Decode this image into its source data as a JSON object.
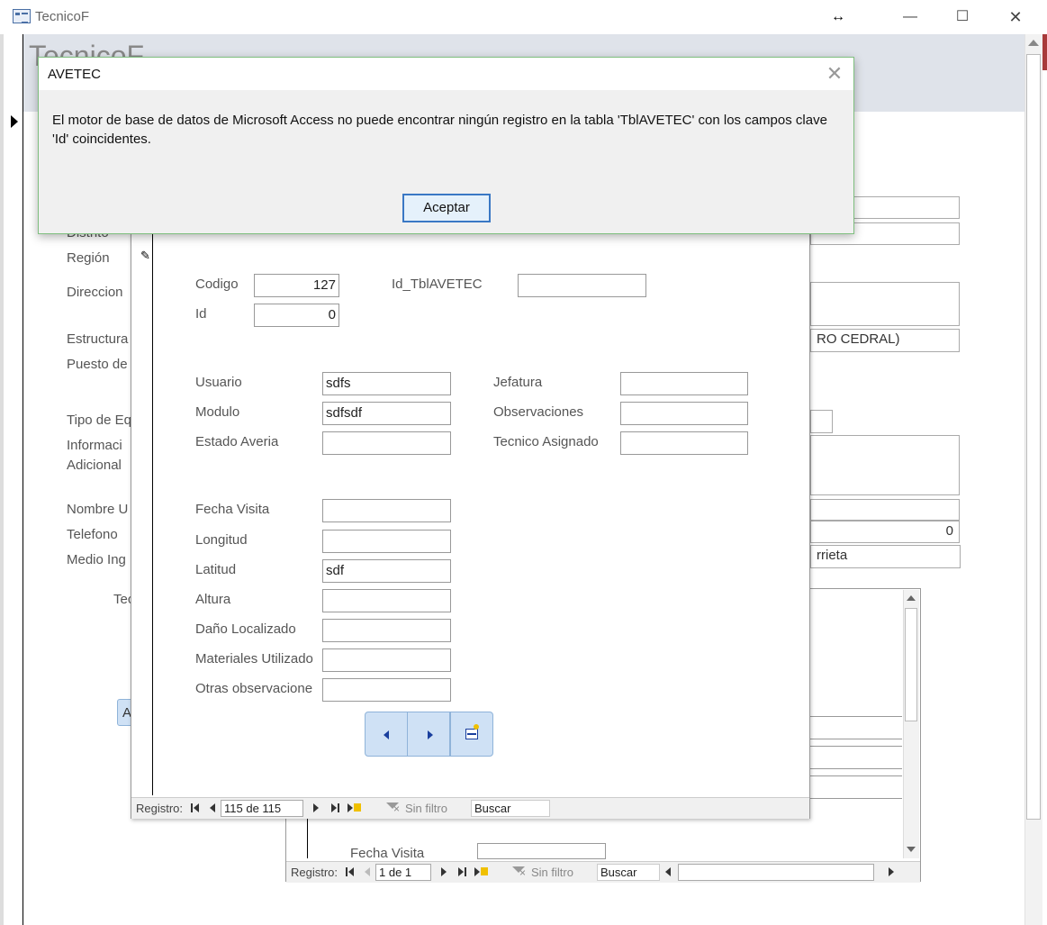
{
  "window": {
    "title": "TecnicoF",
    "header_title": "TecnicoF",
    "resize_glyph": "↔",
    "minimize_glyph": "—",
    "maximize_glyph": "☐",
    "close_glyph": "✕"
  },
  "background_form": {
    "labels": {
      "distrito": "Distrito",
      "region": "Región",
      "direccion": "Direccion",
      "estructura": "Estructura",
      "puesto": "Puesto de",
      "tipo": "Tipo de Eq",
      "informacion": "Informaci",
      "adicional": "Adicional",
      "nombre": "Nombre U",
      "telefono": "Telefono",
      "medio": "Medio Ing",
      "tec": "Tec"
    },
    "fields": {
      "estructura_value": "RO CEDRAL)",
      "telefono_value": "0",
      "medio_value": "rrieta"
    },
    "partial_button": "A"
  },
  "subform": {
    "labels": {
      "codigo": "Codigo",
      "id": "Id",
      "id_tbl": "Id_TblAVETEC",
      "usuario": "Usuario",
      "modulo": "Modulo",
      "estado": "Estado Averia",
      "jefatura": "Jefatura",
      "observaciones": "Observaciones",
      "tecnico": "Tecnico Asignado",
      "fecha": "Fecha Visita",
      "longitud": "Longitud",
      "latitud": "Latitud",
      "altura": "Altura",
      "dano": "Daño Localizado",
      "materiales": "Materiales Utilizado",
      "otras": "Otras observacione"
    },
    "values": {
      "codigo": "127",
      "id": "0",
      "id_tbl": "",
      "usuario": "sdfs",
      "modulo": "sdfsdf",
      "estado": "",
      "jefatura": "",
      "observaciones": "",
      "tecnico": "",
      "fecha": "",
      "longitud": "",
      "latitud": "sdf",
      "altura": "",
      "dano": "",
      "materiales": "",
      "otras": ""
    },
    "recbar": {
      "label": "Registro:",
      "position": "115 de 115",
      "filter": "Sin filtro",
      "search": "Buscar"
    }
  },
  "lowerform": {
    "fecha_label": "Fecha Visita",
    "recbar": {
      "label": "Registro:",
      "position": "1 de 1",
      "filter": "Sin filtro",
      "search": "Buscar"
    }
  },
  "dialog": {
    "title": "AVETEC",
    "message": "El motor de base de datos de Microsoft Access no puede encontrar ningún registro en la tabla 'TblAVETEC' con los campos clave 'Id' coincidentes.",
    "ok_label": "Aceptar",
    "close_glyph": "✕"
  }
}
